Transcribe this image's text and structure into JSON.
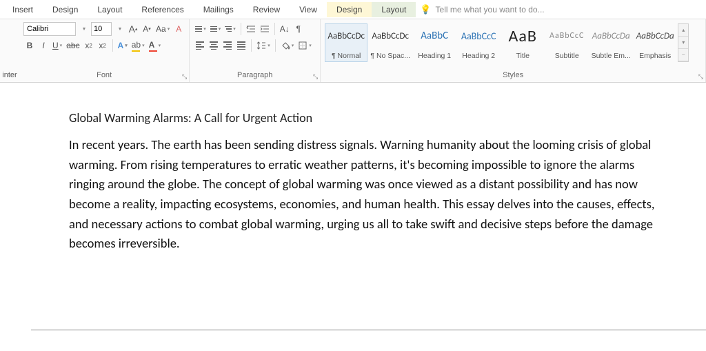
{
  "menu": {
    "items": [
      "Insert",
      "Design",
      "Layout",
      "References",
      "Mailings",
      "Review",
      "View",
      "Design",
      "Layout"
    ],
    "tell_me": "Tell me what you want to do..."
  },
  "font": {
    "name": "Calibri",
    "size": "10",
    "grow": "A",
    "shrink": "A",
    "case": "Aa",
    "group_label": "Font"
  },
  "paragraph": {
    "group_label": "Paragraph"
  },
  "styles": {
    "group_label": "Styles",
    "items": [
      {
        "sample": "AaBbCcDc",
        "name": "¶ Normal",
        "cls": "",
        "selected": true
      },
      {
        "sample": "AaBbCcDc",
        "name": "¶ No Spac...",
        "cls": ""
      },
      {
        "sample": "AaBbC",
        "name": "Heading 1",
        "cls": "h1"
      },
      {
        "sample": "AaBbCcC",
        "name": "Heading 2",
        "cls": "h2"
      },
      {
        "sample": "AaB",
        "name": "Title",
        "cls": "title"
      },
      {
        "sample": "AaBbCcC",
        "name": "Subtitle",
        "cls": "sub"
      },
      {
        "sample": "AaBbCcDa",
        "name": "Subtle Em...",
        "cls": "emi"
      },
      {
        "sample": "AaBbCcDa",
        "name": "Emphasis",
        "cls": "emp"
      }
    ]
  },
  "inter": "inter",
  "document": {
    "title": "Global Warming Alarms: A Call for Urgent Action",
    "body": "In recent years. The earth has been sending distress signals. Warning humanity about the looming crisis of global warming. From rising temperatures to erratic weather patterns, it's becoming impossible to ignore the alarms ringing around the globe. The concept of global warming was once viewed as a distant possibility and has now become a reality, impacting ecosystems, economies, and human health. This essay delves into the causes, effects, and necessary actions to combat global warming, urging us all to take swift and decisive steps before the damage becomes irreversible."
  }
}
